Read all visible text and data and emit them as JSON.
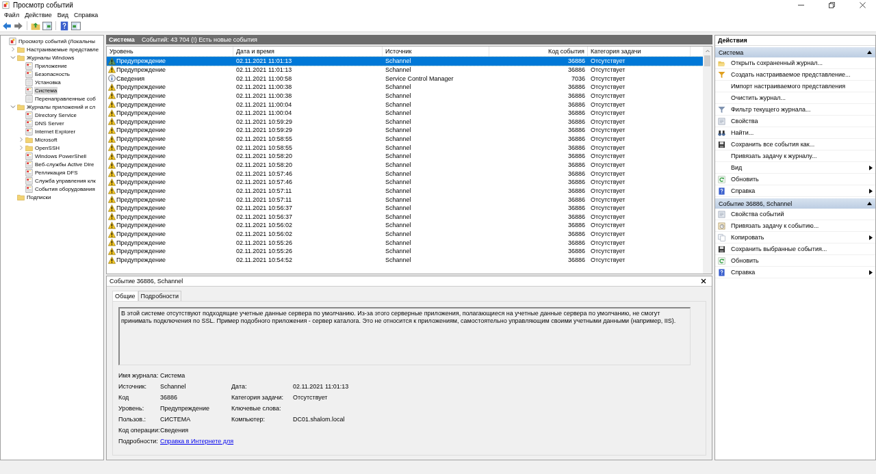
{
  "window": {
    "title": "Просмотр событий"
  },
  "menu": [
    "Файл",
    "Действие",
    "Вид",
    "Справка"
  ],
  "tree": [
    {
      "label": "Просмотр событий (Локальны",
      "kind": "root",
      "selected": false,
      "children": [
        {
          "label": "Настраиваемые представле",
          "kind": "folder",
          "expanded": false,
          "selected": false
        },
        {
          "label": "Журналы Windows",
          "kind": "folder",
          "expanded": true,
          "selected": false,
          "children": [
            {
              "label": "Приложение",
              "kind": "log",
              "selected": false
            },
            {
              "label": "Безопасность",
              "kind": "log",
              "selected": false
            },
            {
              "label": "Установка",
              "kind": "blank",
              "selected": false
            },
            {
              "label": "Система",
              "kind": "log",
              "selected": true
            },
            {
              "label": "Перенаправленные соб",
              "kind": "blank",
              "selected": false
            }
          ]
        },
        {
          "label": "Журналы приложений и сл",
          "kind": "folder",
          "expanded": true,
          "selected": false,
          "children": [
            {
              "label": "Directory Service",
              "kind": "log",
              "selected": false
            },
            {
              "label": "DNS Server",
              "kind": "log",
              "selected": false
            },
            {
              "label": "Internet Explorer",
              "kind": "log",
              "selected": false
            },
            {
              "label": "Microsoft",
              "kind": "folder",
              "expanded": false,
              "selected": false
            },
            {
              "label": "OpenSSH",
              "kind": "folder",
              "expanded": false,
              "selected": false
            },
            {
              "label": "Windows PowerShell",
              "kind": "log",
              "selected": false
            },
            {
              "label": "Веб-службы Active Dire",
              "kind": "log",
              "selected": false
            },
            {
              "label": "Репликация DFS",
              "kind": "log",
              "selected": false
            },
            {
              "label": "Служба управления клк",
              "kind": "log",
              "selected": false
            },
            {
              "label": "События оборудования",
              "kind": "log",
              "selected": false
            }
          ]
        },
        {
          "label": "Подписки",
          "kind": "folder",
          "selected": false
        }
      ]
    }
  ],
  "log_header": {
    "title": "Система",
    "summary": "Событий: 43 704 (!) Есть новые события"
  },
  "table": {
    "columns": [
      "Уровень",
      "Дата и время",
      "Источник",
      "Код события",
      "Категория задачи"
    ],
    "rows": [
      {
        "level": "Предупреждение",
        "kind": "warning",
        "date": "02.11.2021 11:01:13",
        "source": "Schannel",
        "code": "36886",
        "category": "Отсутствует",
        "selected": true
      },
      {
        "level": "Предупреждение",
        "kind": "warning",
        "date": "02.11.2021 11:01:13",
        "source": "Schannel",
        "code": "36886",
        "category": "Отсутствует",
        "selected": false
      },
      {
        "level": "Сведения",
        "kind": "info",
        "date": "02.11.2021 11:00:58",
        "source": "Service Control Manager",
        "code": "7036",
        "category": "Отсутствует",
        "selected": false
      },
      {
        "level": "Предупреждение",
        "kind": "warning",
        "date": "02.11.2021 11:00:38",
        "source": "Schannel",
        "code": "36886",
        "category": "Отсутствует",
        "selected": false
      },
      {
        "level": "Предупреждение",
        "kind": "warning",
        "date": "02.11.2021 11:00:38",
        "source": "Schannel",
        "code": "36886",
        "category": "Отсутствует",
        "selected": false
      },
      {
        "level": "Предупреждение",
        "kind": "warning",
        "date": "02.11.2021 11:00:04",
        "source": "Schannel",
        "code": "36886",
        "category": "Отсутствует",
        "selected": false
      },
      {
        "level": "Предупреждение",
        "kind": "warning",
        "date": "02.11.2021 11:00:04",
        "source": "Schannel",
        "code": "36886",
        "category": "Отсутствует",
        "selected": false
      },
      {
        "level": "Предупреждение",
        "kind": "warning",
        "date": "02.11.2021 10:59:29",
        "source": "Schannel",
        "code": "36886",
        "category": "Отсутствует",
        "selected": false
      },
      {
        "level": "Предупреждение",
        "kind": "warning",
        "date": "02.11.2021 10:59:29",
        "source": "Schannel",
        "code": "36886",
        "category": "Отсутствует",
        "selected": false
      },
      {
        "level": "Предупреждение",
        "kind": "warning",
        "date": "02.11.2021 10:58:55",
        "source": "Schannel",
        "code": "36886",
        "category": "Отсутствует",
        "selected": false
      },
      {
        "level": "Предупреждение",
        "kind": "warning",
        "date": "02.11.2021 10:58:55",
        "source": "Schannel",
        "code": "36886",
        "category": "Отсутствует",
        "selected": false
      },
      {
        "level": "Предупреждение",
        "kind": "warning",
        "date": "02.11.2021 10:58:20",
        "source": "Schannel",
        "code": "36886",
        "category": "Отсутствует",
        "selected": false
      },
      {
        "level": "Предупреждение",
        "kind": "warning",
        "date": "02.11.2021 10:58:20",
        "source": "Schannel",
        "code": "36886",
        "category": "Отсутствует",
        "selected": false
      },
      {
        "level": "Предупреждение",
        "kind": "warning",
        "date": "02.11.2021 10:57:46",
        "source": "Schannel",
        "code": "36886",
        "category": "Отсутствует",
        "selected": false
      },
      {
        "level": "Предупреждение",
        "kind": "warning",
        "date": "02.11.2021 10:57:46",
        "source": "Schannel",
        "code": "36886",
        "category": "Отсутствует",
        "selected": false
      },
      {
        "level": "Предупреждение",
        "kind": "warning",
        "date": "02.11.2021 10:57:11",
        "source": "Schannel",
        "code": "36886",
        "category": "Отсутствует",
        "selected": false
      },
      {
        "level": "Предупреждение",
        "kind": "warning",
        "date": "02.11.2021 10:57:11",
        "source": "Schannel",
        "code": "36886",
        "category": "Отсутствует",
        "selected": false
      },
      {
        "level": "Предупреждение",
        "kind": "warning",
        "date": "02.11.2021 10:56:37",
        "source": "Schannel",
        "code": "36886",
        "category": "Отсутствует",
        "selected": false
      },
      {
        "level": "Предупреждение",
        "kind": "warning",
        "date": "02.11.2021 10:56:37",
        "source": "Schannel",
        "code": "36886",
        "category": "Отсутствует",
        "selected": false
      },
      {
        "level": "Предупреждение",
        "kind": "warning",
        "date": "02.11.2021 10:56:02",
        "source": "Schannel",
        "code": "36886",
        "category": "Отсутствует",
        "selected": false
      },
      {
        "level": "Предупреждение",
        "kind": "warning",
        "date": "02.11.2021 10:56:02",
        "source": "Schannel",
        "code": "36886",
        "category": "Отсутствует",
        "selected": false
      },
      {
        "level": "Предупреждение",
        "kind": "warning",
        "date": "02.11.2021 10:55:26",
        "source": "Schannel",
        "code": "36886",
        "category": "Отсутствует",
        "selected": false
      },
      {
        "level": "Предупреждение",
        "kind": "warning",
        "date": "02.11.2021 10:55:26",
        "source": "Schannel",
        "code": "36886",
        "category": "Отсутствует",
        "selected": false
      },
      {
        "level": "Предупреждение",
        "kind": "warning",
        "date": "02.11.2021 10:54:52",
        "source": "Schannel",
        "code": "36886",
        "category": "Отсутствует",
        "selected": false
      }
    ]
  },
  "details": {
    "title": "Событие 36886, Schannel",
    "tabs": [
      {
        "label": "Общие",
        "selected": true
      },
      {
        "label": "Подробности",
        "selected": false
      }
    ],
    "description": "В этой системе отсутствуют подходящие учетные данные сервера по умолчанию. Из-за этого серверные приложения, полагающиеся на учетные данные сервера по умолчанию, не смогут принимать подключения по SSL. Пример подобного приложения - сервер каталога. Это не относится к приложениям, самостоятельно управляющим своими учетными данными (например, IIS).",
    "fields_left": [
      {
        "label": "Имя журнала:",
        "value": "Система"
      },
      {
        "label": "Источник:",
        "value": "Schannel"
      },
      {
        "label": "Код",
        "value": "36886"
      },
      {
        "label": "Уровень:",
        "value": "Предупреждение"
      },
      {
        "label": "Пользов.:",
        "value": "СИСТЕМА"
      },
      {
        "label": "Код операции:",
        "value": "Сведения"
      },
      {
        "label": "Подробности:",
        "link": "Справка в Интернете для"
      }
    ],
    "fields_right": [
      {
        "label": "Дата:",
        "value": "02.11.2021 11:01:13"
      },
      {
        "label": "Категория задачи:",
        "value": "Отсутствует"
      },
      {
        "label": "Ключевые слова:"
      },
      {
        "label": "Компьютер:",
        "value": "DC01.shalom.local"
      }
    ]
  },
  "actions": {
    "title": "Действия",
    "sections": [
      {
        "title": "Система",
        "expanded": true,
        "items": [
          {
            "label": "Открыть сохраненный журнал...",
            "submenu": false
          },
          {
            "label": "Создать настраиваемое представление...",
            "submenu": false
          },
          {
            "label": "Импорт настраиваемого представления",
            "submenu": false
          },
          {
            "label": "Очистить журнал...",
            "submenu": false
          },
          {
            "label": "Фильтр текущего журнала...",
            "submenu": false
          },
          {
            "label": "Свойства",
            "submenu": false
          },
          {
            "label": "Найти...",
            "submenu": false
          },
          {
            "label": "Сохранить все события как...",
            "submenu": false
          },
          {
            "label": "Привязать задачу к журналу...",
            "submenu": false
          },
          {
            "label": "Вид",
            "submenu": true
          },
          {
            "label": "Обновить",
            "submenu": false
          },
          {
            "label": "Справка",
            "submenu": true
          }
        ]
      },
      {
        "title": "Событие 36886, Schannel",
        "expanded": true,
        "items": [
          {
            "label": "Свойства событий",
            "submenu": false
          },
          {
            "label": "Привязать задачу к событию...",
            "submenu": false
          },
          {
            "label": "Копировать",
            "submenu": true
          },
          {
            "label": "Сохранить выбранные события...",
            "submenu": false
          },
          {
            "label": "Обновить",
            "submenu": false
          },
          {
            "label": "Справка",
            "submenu": true
          }
        ]
      }
    ]
  }
}
